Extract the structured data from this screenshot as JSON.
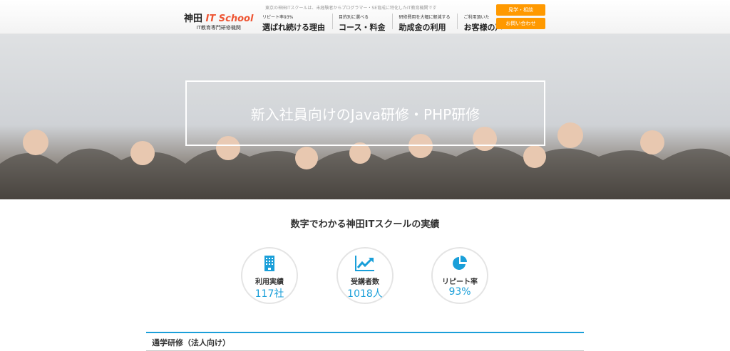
{
  "header": {
    "tagline": "東京の神田ITスクールは、未経験者からプログラマー・SE育成に特化したIT教育機関です",
    "logo": {
      "kanji": "神田",
      "brand": "IT School",
      "sub": "IT教育専門研修機関"
    },
    "nav": [
      {
        "small": "リピート率93%",
        "label": "選ばれ続ける理由"
      },
      {
        "small": "目的別に選べる",
        "label": "コース・料金"
      },
      {
        "small": "研修費用を大幅に軽減する",
        "label": "助成金の利用"
      },
      {
        "small": "ご利用頂いた",
        "label": "お客様の声"
      }
    ],
    "visit_button": "見学・相談",
    "contact_button": "お問い合わせ"
  },
  "hero": {
    "title": "新入社員向けのJava研修・PHP研修"
  },
  "stats": {
    "title": "数字でわかる神田ITスクールの実績",
    "items": [
      {
        "icon": "building-icon",
        "label": "利用実績",
        "value": "117社"
      },
      {
        "icon": "chart-up-icon",
        "label": "受講者数",
        "value": "1018人"
      },
      {
        "icon": "pie-chart-icon",
        "label": "リピート率",
        "value": "93%"
      }
    ]
  },
  "section": {
    "heading": "通学研修（法人向け）"
  },
  "colors": {
    "accent": "#1a9fd9",
    "button": "#ff9900"
  }
}
